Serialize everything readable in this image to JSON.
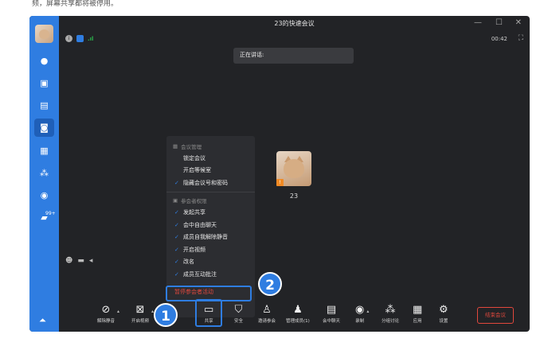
{
  "caption": "频，屏幕共享都将被停用。",
  "window": {
    "title": "23的快速会议",
    "timer": "00:42"
  },
  "window_controls": {
    "minimize": "—",
    "maximize": "☐",
    "close": "✕"
  },
  "speaking": "正在讲话:",
  "participant": {
    "name": "23"
  },
  "menu": {
    "section1": "会议管理",
    "items1": [
      {
        "label": "锁定会议",
        "checked": false
      },
      {
        "label": "开启等候室",
        "checked": false
      },
      {
        "label": "隐藏会议号和密码",
        "checked": true
      }
    ],
    "section2": "参会者权限",
    "items2": [
      {
        "label": "发起共享",
        "checked": true
      },
      {
        "label": "会中自由聊天",
        "checked": true
      },
      {
        "label": "成员自我解除静音",
        "checked": true
      },
      {
        "label": "开启视频",
        "checked": true
      },
      {
        "label": "改名",
        "checked": true
      },
      {
        "label": "成员互动批注",
        "checked": true
      }
    ],
    "danger": "暂停参会者活动"
  },
  "toolbar": {
    "unmute": "解除静音",
    "video": "开启视频",
    "share": "共享",
    "security": "安全",
    "invite": "邀请参会",
    "members": "管理成员(1)",
    "chat": "会中聊天",
    "record": "录制",
    "breakout": "分组讨论",
    "apps": "应用",
    "settings": "设置",
    "end": "结束会议"
  },
  "rail_badge": "99+",
  "steps": [
    "1",
    "2"
  ],
  "colors": {
    "accent": "#2f7de1",
    "danger": "#e2483d",
    "bg": "#222326"
  }
}
